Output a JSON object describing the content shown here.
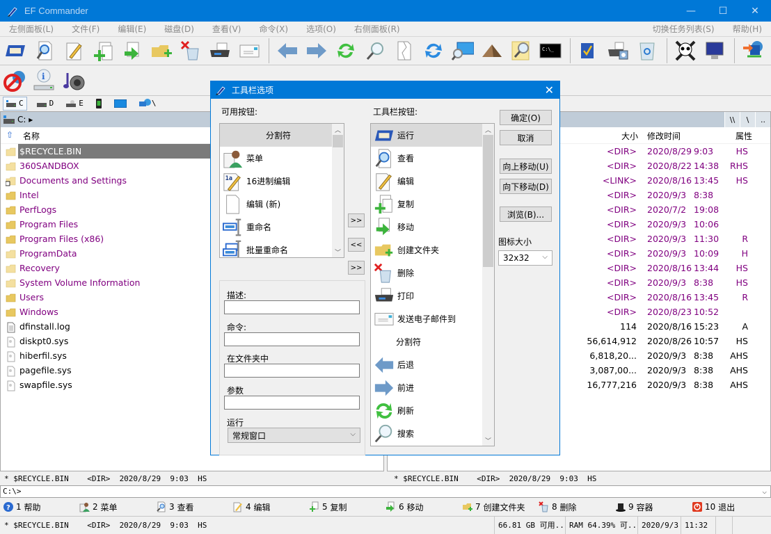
{
  "window": {
    "title": "EF Commander",
    "controls": {
      "minimize": "—",
      "maximize": "☐",
      "close": "✕"
    }
  },
  "menubar": {
    "items": [
      "左侧面板(L)",
      "文件(F)",
      "编辑(E)",
      "磁盘(D)",
      "查看(V)",
      "命令(X)",
      "选项(O)",
      "右侧面板(R)"
    ],
    "right_items": [
      "切换任务列表(S)",
      "帮助(H)"
    ]
  },
  "toolbar": {
    "row1": [
      "run-icon",
      "view-icon",
      "edit-icon",
      "copy-icon",
      "move-icon",
      "new-folder-icon",
      "delete-icon",
      "print-icon",
      "email-icon",
      "back-icon",
      "forward-icon",
      "refresh-icon",
      "search-icon",
      "split-icon",
      "sync-icon",
      "find-screen-icon",
      "pyramid-icon",
      "folder-search-icon",
      "console-icon",
      "checklist-icon",
      "scanner-icon",
      "recycle-bin-icon",
      "skull-icon",
      "monitor-icon",
      "network-transfer-icon"
    ],
    "row2": [
      "disconnect-icon",
      "drive-info-icon",
      "media-icon"
    ]
  },
  "drivebar": {
    "drives": [
      {
        "label": "C",
        "active": true
      },
      {
        "label": "D",
        "active": false
      },
      {
        "label": "E",
        "active": false
      },
      {
        "label": "",
        "active": false
      },
      {
        "label": "",
        "active": false
      },
      {
        "label": "\\",
        "active": false
      }
    ]
  },
  "left_panel": {
    "path": "C: ▸",
    "col_name": "名称",
    "files": [
      {
        "name": "$RECYCLE.BIN",
        "type": "dir",
        "selected": true
      },
      {
        "name": "360SANDBOX",
        "type": "dir"
      },
      {
        "name": "Documents and Settings",
        "type": "link"
      },
      {
        "name": "Intel",
        "type": "dir"
      },
      {
        "name": "PerfLogs",
        "type": "dir"
      },
      {
        "name": "Program Files",
        "type": "dir"
      },
      {
        "name": "Program Files (x86)",
        "type": "dir"
      },
      {
        "name": "ProgramData",
        "type": "dir"
      },
      {
        "name": "Recovery",
        "type": "dir"
      },
      {
        "name": "System Volume Information",
        "type": "dir"
      },
      {
        "name": "Users",
        "type": "dir"
      },
      {
        "name": "Windows",
        "type": "dir"
      },
      {
        "name": "dfinstall.log",
        "type": "file"
      },
      {
        "name": "diskpt0.sys",
        "type": "sys"
      },
      {
        "name": "hiberfil.sys",
        "type": "sys"
      },
      {
        "name": "pagefile.sys",
        "type": "sys"
      },
      {
        "name": "swapfile.sys",
        "type": "sys"
      }
    ],
    "status": "* $RECYCLE.BIN    <DIR>  2020/8/29  9:03  HS"
  },
  "right_panel": {
    "path_buttons": [
      "\\\\",
      "\\",
      ".."
    ],
    "columns": {
      "size": "大小",
      "modified": "修改时间",
      "attr": "属性"
    },
    "rows": [
      {
        "size": "<DIR>",
        "date": "2020/8/29",
        "time": "9:03",
        "attr": "HS",
        "dir": true
      },
      {
        "size": "<DIR>",
        "date": "2020/8/22",
        "time": "14:38",
        "attr": "RHS",
        "dir": true
      },
      {
        "size": "<LINK>",
        "date": "2020/8/16",
        "time": "13:45",
        "attr": "HS",
        "dir": true
      },
      {
        "size": "<DIR>",
        "date": "2020/9/3",
        "time": "8:38",
        "attr": "",
        "dir": true
      },
      {
        "size": "<DIR>",
        "date": "2020/7/2",
        "time": "19:08",
        "attr": "",
        "dir": true
      },
      {
        "size": "<DIR>",
        "date": "2020/9/3",
        "time": "10:06",
        "attr": "",
        "dir": true
      },
      {
        "size": "<DIR>",
        "date": "2020/9/3",
        "time": "11:30",
        "attr": "R",
        "dir": true
      },
      {
        "size": "<DIR>",
        "date": "2020/9/3",
        "time": "10:09",
        "attr": "H",
        "dir": true
      },
      {
        "size": "<DIR>",
        "date": "2020/8/16",
        "time": "13:44",
        "attr": "HS",
        "dir": true
      },
      {
        "size": "<DIR>",
        "date": "2020/9/3",
        "time": "8:38",
        "attr": "HS",
        "dir": true
      },
      {
        "size": "<DIR>",
        "date": "2020/8/16",
        "time": "13:45",
        "attr": "R",
        "dir": true
      },
      {
        "size": "<DIR>",
        "date": "2020/8/23",
        "time": "10:52",
        "attr": "",
        "dir": true
      },
      {
        "size": "114",
        "date": "2020/8/16",
        "time": "15:23",
        "attr": "A",
        "dir": false
      },
      {
        "size": "56,614,912",
        "date": "2020/8/26",
        "time": "10:57",
        "attr": "HS",
        "dir": false
      },
      {
        "size": "6,818,20...",
        "date": "2020/9/3",
        "time": "8:38",
        "attr": "AHS",
        "dir": false
      },
      {
        "size": "3,087,00...",
        "date": "2020/9/3",
        "time": "8:38",
        "attr": "AHS",
        "dir": false
      },
      {
        "size": "16,777,216",
        "date": "2020/9/3",
        "time": "8:38",
        "attr": "AHS",
        "dir": false
      }
    ],
    "status": "* $RECYCLE.BIN    <DIR>  2020/8/29  9:03  HS"
  },
  "cmdline": {
    "value": "C:\\>"
  },
  "fnkeys": [
    {
      "key": "1",
      "label": "帮助",
      "icon": "help-icon"
    },
    {
      "key": "2",
      "label": "菜单",
      "icon": "menu-icon"
    },
    {
      "key": "3",
      "label": "查看",
      "icon": "view-icon"
    },
    {
      "key": "4",
      "label": "编辑",
      "icon": "edit-icon"
    },
    {
      "key": "5",
      "label": "复制",
      "icon": "copy-icon"
    },
    {
      "key": "6",
      "label": "移动",
      "icon": "move-icon"
    },
    {
      "key": "7",
      "label": "创建文件夹",
      "icon": "new-folder-icon"
    },
    {
      "key": "8",
      "label": "删除",
      "icon": "delete-icon"
    },
    {
      "key": "9",
      "label": "容器",
      "icon": "container-icon"
    },
    {
      "key": "10",
      "label": "退出",
      "icon": "exit-icon"
    }
  ],
  "bottombar": {
    "status": "* $RECYCLE.BIN    <DIR>  2020/8/29  9:03  HS",
    "free_space": "66.81 GB 可用...",
    "ram": "RAM 64.39% 可...",
    "date": "2020/9/3",
    "time": "11:32"
  },
  "dialog": {
    "title": "工具栏选项",
    "available_label": "可用按钮:",
    "available": [
      {
        "label": "分割符",
        "icon": ""
      },
      {
        "label": "菜单",
        "icon": "menu-icon"
      },
      {
        "label": "16进制编辑",
        "icon": "hex-edit-icon"
      },
      {
        "label": "编辑 (新)",
        "icon": "new-file-icon"
      },
      {
        "label": "重命名",
        "icon": "rename-icon"
      },
      {
        "label": "批量重命名",
        "icon": "batch-rename-icon"
      }
    ],
    "toolbar_label": "工具栏按钮:",
    "toolbar_buttons": [
      {
        "label": "运行",
        "icon": "run-icon"
      },
      {
        "label": "查看",
        "icon": "view-icon"
      },
      {
        "label": "编辑",
        "icon": "edit-icon"
      },
      {
        "label": "复制",
        "icon": "copy-icon"
      },
      {
        "label": "移动",
        "icon": "move-icon"
      },
      {
        "label": "创建文件夹",
        "icon": "new-folder-icon"
      },
      {
        "label": "删除",
        "icon": "delete-icon"
      },
      {
        "label": "打印",
        "icon": "print-icon"
      },
      {
        "label": "发送电子邮件到",
        "icon": "email-icon"
      },
      {
        "label": "分割符",
        "icon": ""
      },
      {
        "label": "后退",
        "icon": "back-icon"
      },
      {
        "label": "前进",
        "icon": "forward-icon"
      },
      {
        "label": "刷新",
        "icon": "refresh-icon"
      },
      {
        "label": "搜索",
        "icon": "search-icon"
      }
    ],
    "add_btn": ">>",
    "remove_btn": "<<",
    "add_btn2": ">>",
    "ok": "确定(O)",
    "cancel": "取消",
    "move_up": "向上移动(U)",
    "move_down": "向下移动(D)",
    "browse": "浏览(B)...",
    "icon_size_label": "图标大小",
    "icon_size_value": "32x32",
    "desc_label": "描述:",
    "desc_value": "",
    "cmd_label": "命令:",
    "cmd_value": "",
    "folder_label": "在文件夹中",
    "folder_value": "",
    "params_label": "参数",
    "params_value": "",
    "run_label": "运行",
    "run_value": "常规窗口"
  }
}
